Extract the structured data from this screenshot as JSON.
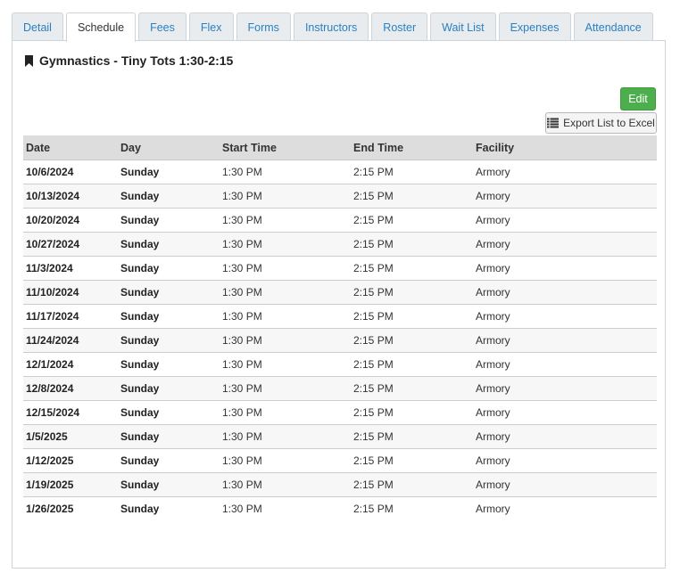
{
  "tabs": [
    {
      "label": "Detail",
      "active": false
    },
    {
      "label": "Schedule",
      "active": true
    },
    {
      "label": "Fees",
      "active": false
    },
    {
      "label": "Flex",
      "active": false
    },
    {
      "label": "Forms",
      "active": false
    },
    {
      "label": "Instructors",
      "active": false
    },
    {
      "label": "Roster",
      "active": false
    },
    {
      "label": "Wait List",
      "active": false
    },
    {
      "label": "Expenses",
      "active": false
    },
    {
      "label": "Attendance",
      "active": false
    }
  ],
  "page": {
    "title": "Gymnastics - Tiny Tots 1:30-2:15",
    "title_icon": "bookmark-icon"
  },
  "toolbar": {
    "edit_label": "Edit",
    "export_label": "Export List to Excel",
    "export_icon": "list-icon",
    "edit_color": "#4cae4c"
  },
  "table": {
    "headers": {
      "date": "Date",
      "day": "Day",
      "start": "Start Time",
      "end": "End Time",
      "facility": "Facility"
    },
    "rows": [
      {
        "date": "10/6/2024",
        "day": "Sunday",
        "start": "1:30 PM",
        "end": "2:15 PM",
        "facility": "Armory"
      },
      {
        "date": "10/13/2024",
        "day": "Sunday",
        "start": "1:30 PM",
        "end": "2:15 PM",
        "facility": "Armory"
      },
      {
        "date": "10/20/2024",
        "day": "Sunday",
        "start": "1:30 PM",
        "end": "2:15 PM",
        "facility": "Armory"
      },
      {
        "date": "10/27/2024",
        "day": "Sunday",
        "start": "1:30 PM",
        "end": "2:15 PM",
        "facility": "Armory"
      },
      {
        "date": "11/3/2024",
        "day": "Sunday",
        "start": "1:30 PM",
        "end": "2:15 PM",
        "facility": "Armory"
      },
      {
        "date": "11/10/2024",
        "day": "Sunday",
        "start": "1:30 PM",
        "end": "2:15 PM",
        "facility": "Armory"
      },
      {
        "date": "11/17/2024",
        "day": "Sunday",
        "start": "1:30 PM",
        "end": "2:15 PM",
        "facility": "Armory"
      },
      {
        "date": "11/24/2024",
        "day": "Sunday",
        "start": "1:30 PM",
        "end": "2:15 PM",
        "facility": "Armory"
      },
      {
        "date": "12/1/2024",
        "day": "Sunday",
        "start": "1:30 PM",
        "end": "2:15 PM",
        "facility": "Armory"
      },
      {
        "date": "12/8/2024",
        "day": "Sunday",
        "start": "1:30 PM",
        "end": "2:15 PM",
        "facility": "Armory"
      },
      {
        "date": "12/15/2024",
        "day": "Sunday",
        "start": "1:30 PM",
        "end": "2:15 PM",
        "facility": "Armory"
      },
      {
        "date": "1/5/2025",
        "day": "Sunday",
        "start": "1:30 PM",
        "end": "2:15 PM",
        "facility": "Armory"
      },
      {
        "date": "1/12/2025",
        "day": "Sunday",
        "start": "1:30 PM",
        "end": "2:15 PM",
        "facility": "Armory"
      },
      {
        "date": "1/19/2025",
        "day": "Sunday",
        "start": "1:30 PM",
        "end": "2:15 PM",
        "facility": "Armory"
      },
      {
        "date": "1/26/2025",
        "day": "Sunday",
        "start": "1:30 PM",
        "end": "2:15 PM",
        "facility": "Armory"
      }
    ]
  }
}
